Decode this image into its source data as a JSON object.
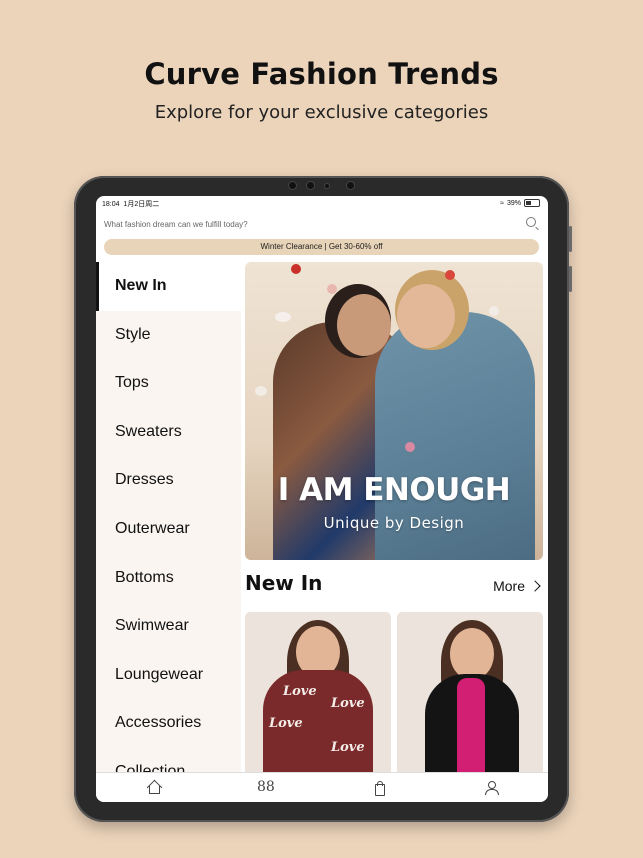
{
  "headline": "Curve Fashion Trends",
  "subheadline": "Explore for your exclusive categories",
  "status": {
    "time": "18:04",
    "date": "1月2日周二",
    "battery": "39%"
  },
  "search": {
    "placeholder": "What fashion dream can we fulfill today?"
  },
  "promo": {
    "text": "Winter Clearance | Get 30-60% off"
  },
  "sidebar": {
    "items": [
      {
        "label": "New In",
        "active": true
      },
      {
        "label": "Style"
      },
      {
        "label": "Tops"
      },
      {
        "label": "Sweaters"
      },
      {
        "label": "Dresses"
      },
      {
        "label": "Outerwear"
      },
      {
        "label": "Bottoms"
      },
      {
        "label": "Swimwear"
      },
      {
        "label": "Loungewear"
      },
      {
        "label": "Accessories"
      },
      {
        "label": "Collection"
      }
    ]
  },
  "banner": {
    "title": "I AM ENOUGH",
    "subtitle": "Unique by Design"
  },
  "section": {
    "title": "New In",
    "more_label": "More"
  },
  "products": [
    {
      "image": "sweater-love-print-icon"
    },
    {
      "image": "black-blazer-pink-dress-icon"
    }
  ],
  "tabbar": {
    "icons": [
      "home-icon",
      "categories-icon",
      "bag-icon",
      "account-icon"
    ]
  },
  "colors": {
    "background": "#ecd4bb",
    "promo": "#e8d4b8",
    "sidebar": "#faf5f1",
    "sweater": "#7a2a2a"
  }
}
